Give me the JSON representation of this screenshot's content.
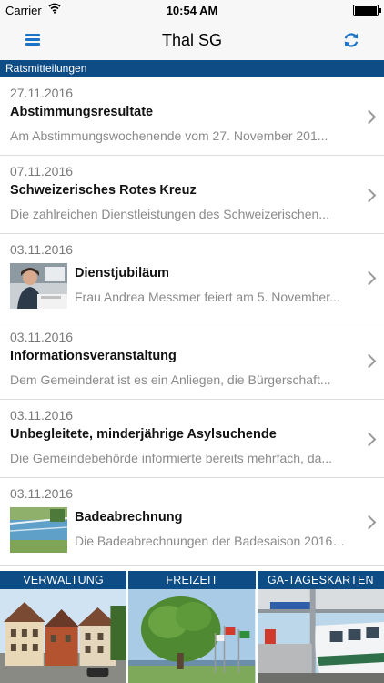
{
  "status_bar": {
    "carrier": "Carrier",
    "time": "10:54 AM"
  },
  "navbar": {
    "title": "Thal SG",
    "menu_icon": "hamburger-menu-icon",
    "refresh_icon": "refresh-icon"
  },
  "section": {
    "title": "Ratsmitteilungen"
  },
  "news": [
    {
      "date": "27.11.2016",
      "title": "Abstimmungsresultate",
      "teaser": "Am Abstimmungswochenende vom 27. November 201..."
    },
    {
      "date": "07.11.2016",
      "title": "Schweizerisches Rotes Kreuz",
      "teaser": "Die zahlreichen Dienstleistungen des Schweizerischen..."
    },
    {
      "date": "03.11.2016",
      "title": "Dienstjubiläum",
      "teaser": "Frau Andrea Messmer feiert am 5. November..."
    },
    {
      "date": "03.11.2016",
      "title": "Informationsveranstaltung",
      "teaser": "Dem Gemeinderat ist es ein Anliegen, die Bürgerschaft..."
    },
    {
      "date": "03.11.2016",
      "title": "Unbegleitete, minderjährige Asylsuchende",
      "teaser": "Die Gemeindebehörde informierte bereits mehrfach, da..."
    },
    {
      "date": "03.11.2016",
      "title": "Badeabrechnung",
      "teaser": "Die Badeabrechnungen der Badesaison 2016 l..."
    }
  ],
  "tiles": [
    {
      "label": "VERWALTUNG"
    },
    {
      "label": "FREIZEIT"
    },
    {
      "label": "GA-TAGESKARTEN"
    }
  ],
  "colors": {
    "accent": "#1a74c9",
    "header_bar": "#0e4c85"
  }
}
